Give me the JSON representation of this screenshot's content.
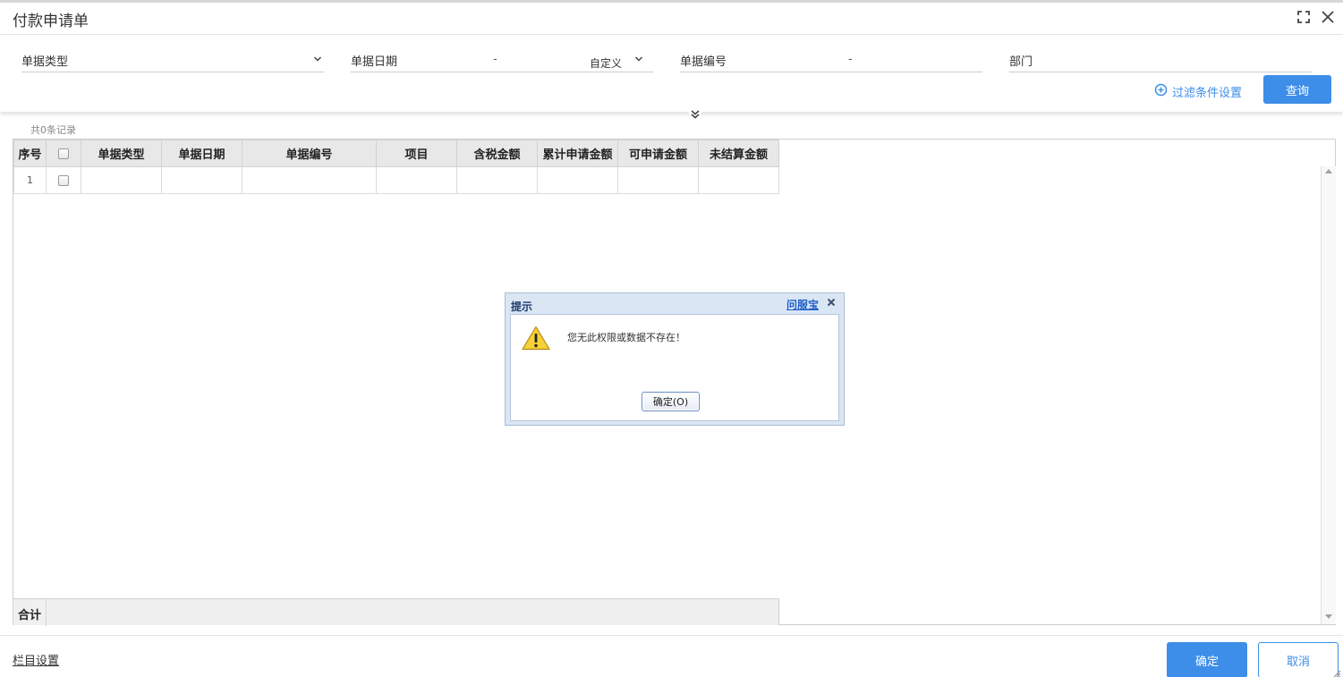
{
  "window": {
    "title": "付款申请单"
  },
  "filters": {
    "doc_type_label": "单据类型",
    "doc_date_label": "单据日期",
    "doc_date_dash": "-",
    "doc_date_range": "自定义",
    "doc_no_label": "单据编号",
    "doc_no_dash": "-",
    "dept_label": "部门",
    "filter_settings_label": "过滤条件设置",
    "query_label": "查询"
  },
  "grid": {
    "record_count": "共0条记录",
    "columns": [
      "序号",
      "",
      "单据类型",
      "单据日期",
      "单据编号",
      "项目",
      "含税金额",
      "累计申请金额",
      "可申请金额",
      "未结算金额"
    ],
    "rows": [
      {
        "index": "1"
      }
    ],
    "total_label": "合计"
  },
  "dialog": {
    "title": "提示",
    "help_link": "问服宝",
    "message": "您无此权限或数据不存在！",
    "ok_label": "确定(O)"
  },
  "footer": {
    "column_settings_label": "栏目设置",
    "confirm_label": "确定",
    "cancel_label": "取消"
  },
  "colors": {
    "accent": "#3d8ee8",
    "dialog_frame": "#dbe6f5",
    "header_bg": "#e8e8e8"
  }
}
